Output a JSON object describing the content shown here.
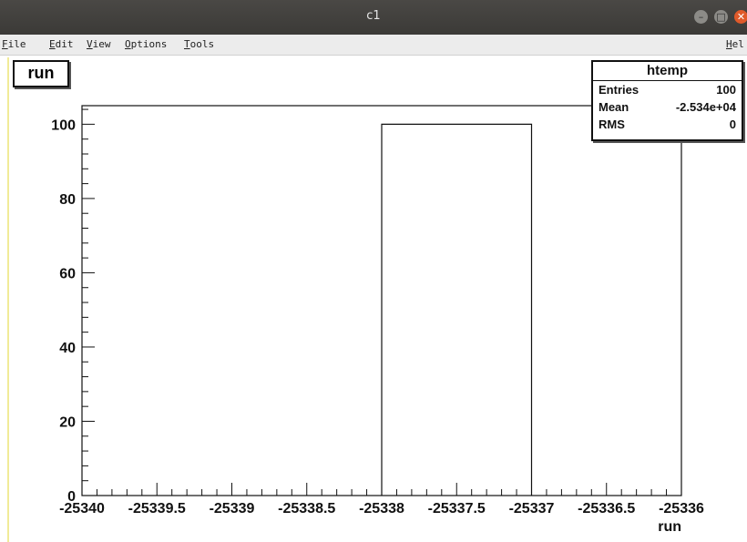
{
  "window": {
    "title": "c1",
    "controls": [
      "minimize",
      "maximize",
      "close"
    ]
  },
  "menubar": {
    "items": [
      {
        "first": "F",
        "rest": "ile"
      },
      {
        "first": "E",
        "rest": "dit"
      },
      {
        "first": "V",
        "rest": "iew"
      },
      {
        "first": "O",
        "rest": "ptions"
      },
      {
        "first": "T",
        "rest": "ools"
      },
      {
        "first": "H",
        "rest": "el"
      }
    ]
  },
  "pad_label": "run",
  "stats_box": {
    "title": "htemp",
    "rows": [
      {
        "key": "Entries",
        "value": "100"
      },
      {
        "key": "Mean",
        "value": "-2.534e+04"
      },
      {
        "key": "RMS",
        "value": "0"
      }
    ]
  },
  "chart_data": {
    "type": "bar",
    "title": "",
    "xlabel": "run",
    "ylabel": "",
    "xlim": [
      -25340,
      -25336
    ],
    "ylim": [
      0,
      105
    ],
    "x_ticks": [
      "-25340",
      "-25339.5",
      "-25339",
      "-25338.5",
      "-25338",
      "-25337.5",
      "-25337",
      "-25336.5",
      "-25336"
    ],
    "y_ticks": [
      "0",
      "20",
      "40",
      "60",
      "80",
      "100"
    ],
    "bins": [
      {
        "low": -25338,
        "high": -25337,
        "value": 100
      }
    ],
    "legend": "none",
    "grid": false
  }
}
